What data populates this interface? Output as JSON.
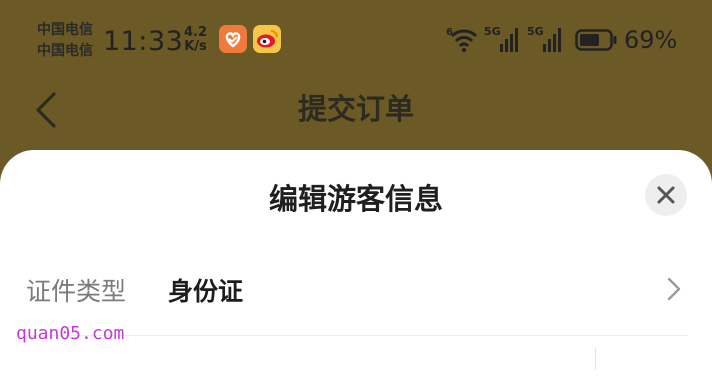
{
  "status_bar": {
    "carrier_1": "中国电信",
    "carrier_2": "中国电信",
    "time": "11:33",
    "net_speed_value": "4.2",
    "net_speed_unit": "K/s",
    "wifi_label": "6",
    "sim1_label": "5G",
    "sim2_label": "5G",
    "battery_percent": "69%",
    "battery_level": 0.69
  },
  "nav": {
    "title": "提交订单"
  },
  "sheet": {
    "title": "编辑游客信息",
    "id_type_label": "证件类型",
    "id_type_value": "身份证"
  },
  "watermark": "quan05.com",
  "colors": {
    "header_bg": "#6b5a26",
    "sheet_bg": "#ffffff",
    "watermark": "#c43ad8",
    "health_app": "#f07a3c",
    "weibo_app": "#f7c646"
  }
}
